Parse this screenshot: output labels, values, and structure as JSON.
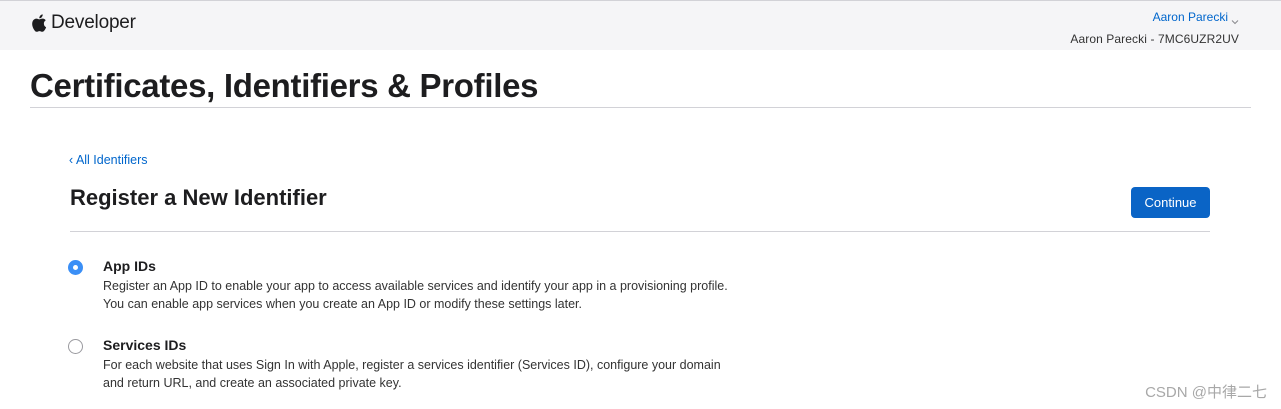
{
  "header": {
    "brand": "Developer",
    "account_name": "Aaron Parecki",
    "account_team": "Aaron Parecki - 7MC6UZR2UV"
  },
  "page": {
    "title": "Certificates, Identifiers & Profiles"
  },
  "content": {
    "back_link": "‹ All Identifiers",
    "section_title": "Register a New Identifier",
    "continue_label": "Continue",
    "options": [
      {
        "label": "App IDs",
        "description": "Register an App ID to enable your app to access available services and identify your app in a provisioning profile. You can enable app services when you create an App ID or modify these settings later.",
        "selected": true
      },
      {
        "label": "Services IDs",
        "description": "For each website that uses Sign In with Apple, register a services identifier (Services ID), configure your domain and return URL, and create an associated private key.",
        "selected": false
      }
    ]
  },
  "watermark": "CSDN @中律二七",
  "colors": {
    "accent": "#0066cc",
    "button": "#0a64c6",
    "radio_selected": "#3b8ff6"
  },
  "icons": [
    "apple-logo-icon",
    "chevron-down-icon"
  ]
}
